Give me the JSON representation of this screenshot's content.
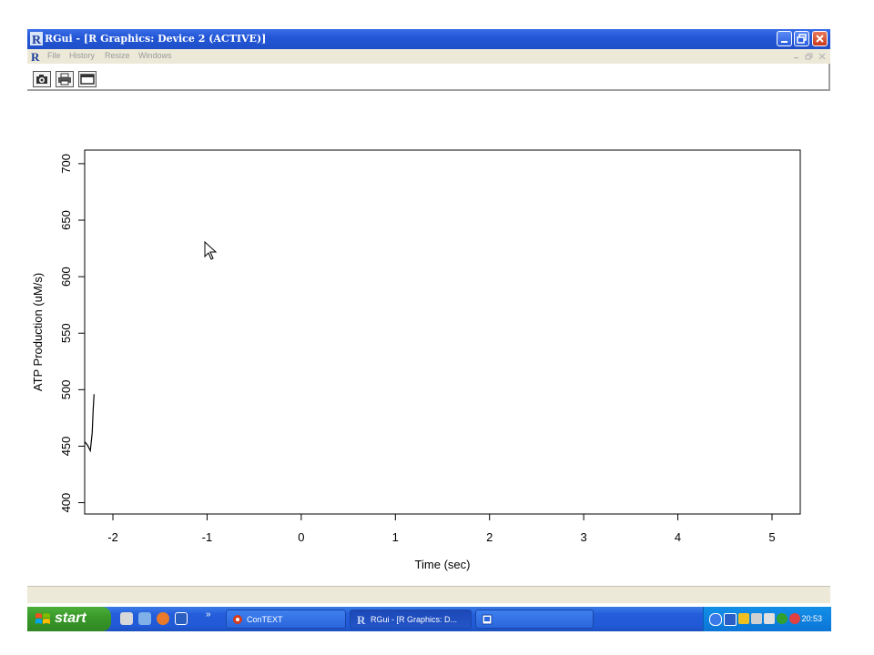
{
  "window": {
    "title": "RGui - [R Graphics: Device 2 (ACTIVE)]",
    "menu": [
      "File",
      "History",
      "Resize",
      "Windows"
    ]
  },
  "toolbar": {
    "icons": [
      "camera-icon",
      "printer-icon",
      "window-icon"
    ]
  },
  "chart_data": {
    "type": "line",
    "xlabel": "Time (sec)",
    "ylabel": "ATP Production (uM/s)",
    "xlim": [
      -2.3,
      5.3
    ],
    "ylim": [
      390,
      712
    ],
    "x_ticks": [
      "-2",
      "-1",
      "0",
      "1",
      "2",
      "3",
      "4",
      "5"
    ],
    "y_ticks": [
      "400",
      "450",
      "500",
      "550",
      "600",
      "650",
      "700"
    ],
    "series": [
      {
        "x": [
          -2.3,
          -2.27,
          -2.24,
          -2.22,
          -2.21,
          -2.2
        ],
        "y": [
          454,
          451,
          446,
          462,
          482,
          496
        ]
      }
    ]
  },
  "taskbar": {
    "start_label": "start",
    "tasks": [
      {
        "label": "ConTEXT"
      },
      {
        "label": "RGui - [R Graphics: D..."
      },
      {
        "label": ""
      }
    ],
    "clock": "20:53"
  }
}
